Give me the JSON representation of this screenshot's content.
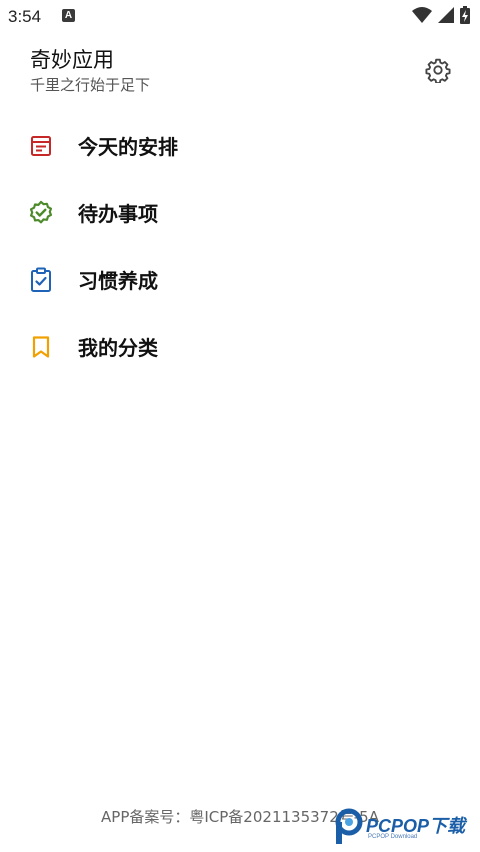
{
  "status_bar": {
    "time": "3:54",
    "notification_icon": "a-notification-icon",
    "icons": [
      "wifi-icon",
      "cell-signal-icon",
      "battery-charging-icon"
    ]
  },
  "header": {
    "title": "奇妙应用",
    "subtitle": "千里之行始于足下",
    "settings_icon": "gear-icon"
  },
  "menu": {
    "items": [
      {
        "label": "今天的安排",
        "icon": "calendar-note-icon",
        "color": "#c62828"
      },
      {
        "label": "待办事项",
        "icon": "verified-badge-icon",
        "color": "#4c8a2a"
      },
      {
        "label": "习惯养成",
        "icon": "clipboard-check-icon",
        "color": "#1e63b8"
      },
      {
        "label": "我的分类",
        "icon": "bookmark-icon",
        "color": "#f0a000"
      }
    ]
  },
  "footer": {
    "icp_text": "APP备案号：粤ICP备2021135372号-5A"
  },
  "watermark": {
    "brand": "PCPOP下载",
    "tagline": "PCPOP Download"
  }
}
